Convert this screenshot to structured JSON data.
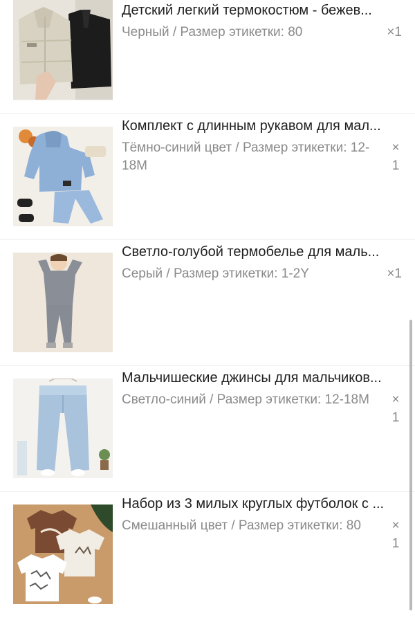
{
  "items": [
    {
      "title": "Детский легкий термокостюм - бежев...",
      "variant": "Черный / Размер этикетки: 80",
      "qty_x": "×",
      "qty_n": "1",
      "qty_label": "×1",
      "image": "vest-pair-image"
    },
    {
      "title": "Комплект с длинным рукавом для мал...",
      "variant": "Тёмно-синий цвет / Размер этикетки: 12-18M",
      "qty_x": "×",
      "qty_n": "1",
      "image": "hoodie-set-image"
    },
    {
      "title": "Светло-голубой термобелье для маль...",
      "variant": "Серый / Размер этикетки: 1-2Y",
      "qty_x": "×",
      "qty_n": "1",
      "qty_label": "×1",
      "image": "thermal-underwear-image"
    },
    {
      "title": "Мальчишеские джинсы для мальчиков...",
      "variant": "Светло-синий / Размер этикетки: 12-18M",
      "qty_x": "×",
      "qty_n": "1",
      "image": "jeans-image"
    },
    {
      "title": "Набор из 3 милых круглых футболок с ...",
      "variant": "Смешанный цвет / Размер этикетки: 80",
      "qty_x": "×",
      "qty_n": "1",
      "image": "tshirt-set-image"
    }
  ]
}
